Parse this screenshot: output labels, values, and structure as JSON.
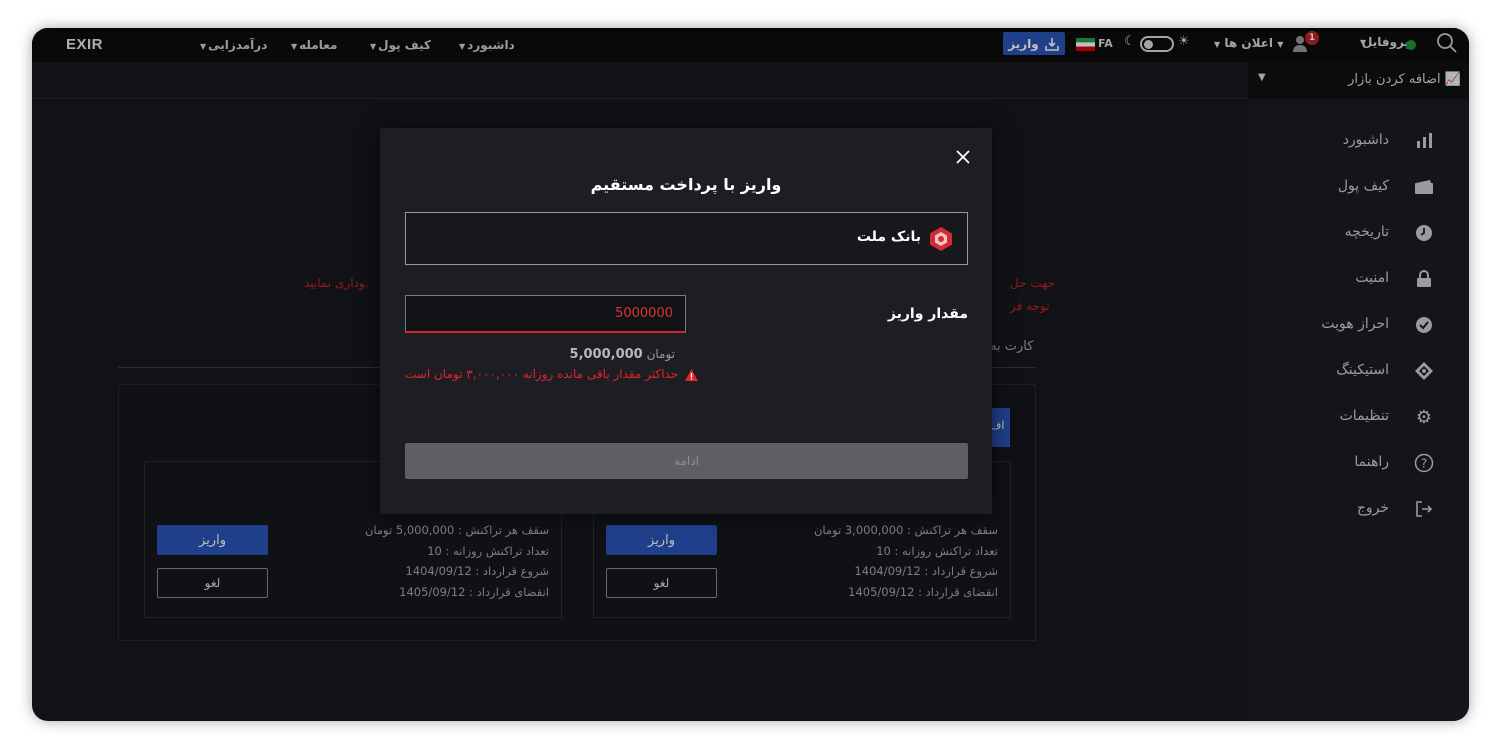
{
  "topbar": {
    "logo": "EXIR",
    "nav": [
      {
        "label": "داشبورد"
      },
      {
        "label": "کیف پول"
      },
      {
        "label": "معامله"
      },
      {
        "label": "درآمدزایی"
      }
    ],
    "deposit_label": "واریز",
    "language": "FA",
    "announcements_label": "اعلان ها",
    "profile_label": "پروفایل",
    "notification_count": "1",
    "online_color": "#1f9a3a"
  },
  "market": {
    "label": "اضافه کردن بازار"
  },
  "sidebar": {
    "items": [
      {
        "label": "داشبورد",
        "icon": "bar-chart-icon"
      },
      {
        "label": "کیف پول",
        "icon": "wallet-icon"
      },
      {
        "label": "تاریخچه",
        "icon": "clock-icon"
      },
      {
        "label": "امنیت",
        "icon": "lock-icon"
      },
      {
        "label": "احراز هویت",
        "icon": "verified-icon"
      },
      {
        "label": "استیکینگ",
        "icon": "staking-icon"
      },
      {
        "label": "تنظیمات",
        "icon": "gear-icon"
      },
      {
        "label": "راهنما",
        "icon": "help-icon"
      },
      {
        "label": "خروج",
        "icon": "logout-icon"
      }
    ]
  },
  "background": {
    "red_line1_right": "جهت جل",
    "red_line1_left": "وداری نمایید.",
    "red_line2_right": "توجه فر",
    "card_section_label": "کارت به",
    "blue_btn_fragment": "اف",
    "cards": [
      {
        "limit": "سقف هر تراکنش : 3,000,000 تومان",
        "daily_count": "تعداد تراکنش روزانه : 10",
        "start": "شروع قرارداد : 1404/09/12",
        "end": "انقضای قرارداد : 1405/09/12",
        "deposit_label": "واریز",
        "cancel_label": "لغو"
      },
      {
        "limit": "سقف هر تراکنش : 5,000,000 تومان",
        "daily_count": "تعداد تراکنش روزانه : 10",
        "start": "شروع قرارداد : 1404/09/12",
        "end": "انقضای قرارداد : 1405/09/12",
        "deposit_label": "واریز",
        "cancel_label": "لغو"
      }
    ]
  },
  "modal": {
    "title": "واریز با پرداخت مستقیم",
    "bank_name": "بانک ملت",
    "amount_label": "مقدار واریز",
    "amount_value": "5000000",
    "amount_formatted": "5,000,000",
    "amount_unit": "تومان",
    "error": "حداکثر مقدار باقی مانده روزانه ۳,۰۰۰,۰۰۰ تومان است",
    "continue_label": "ادامه",
    "accent_color": "#2a55b8",
    "error_color": "#e0252b"
  }
}
